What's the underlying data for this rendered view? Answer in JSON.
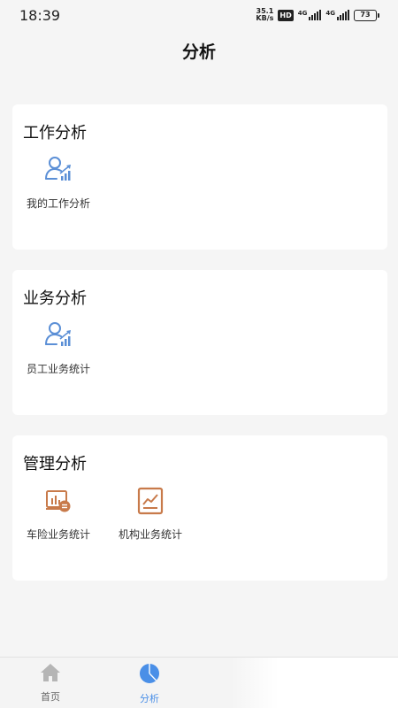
{
  "status_bar": {
    "time": "18:39",
    "net_speed_value": "35.1",
    "net_speed_unit": "KB/s",
    "hd_badge": "HD",
    "signal_1_label": "4G",
    "signal_2_label": "4G",
    "battery_level": "73"
  },
  "page": {
    "title": "分析"
  },
  "sections": [
    {
      "title": "工作分析",
      "items": [
        {
          "label": "我的工作分析",
          "icon": "user-chart-icon"
        }
      ]
    },
    {
      "title": "业务分析",
      "items": [
        {
          "label": "员工业务统计",
          "icon": "user-chart-icon"
        }
      ]
    },
    {
      "title": "管理分析",
      "items": [
        {
          "label": "车险业务统计",
          "icon": "car-insurance-chart-icon"
        },
        {
          "label": "机构业务统计",
          "icon": "org-line-chart-icon"
        }
      ]
    }
  ],
  "bottom_nav": {
    "items": [
      {
        "label": "首页",
        "icon": "home-icon",
        "active": false
      },
      {
        "label": "分析",
        "icon": "pie-chart-icon",
        "active": true
      }
    ]
  },
  "colors": {
    "accent_blue": "#4a8fe7",
    "icon_blue": "#5b8fd6",
    "icon_orange": "#c87a4a",
    "inactive_gray": "#b5b5b5"
  }
}
